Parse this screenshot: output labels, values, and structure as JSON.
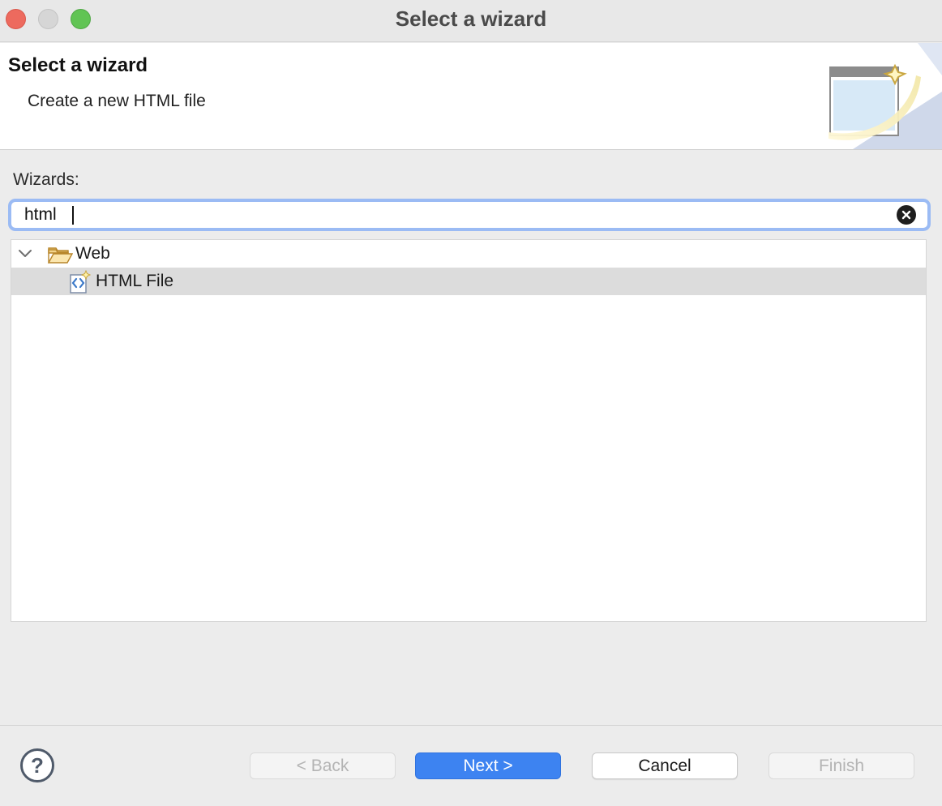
{
  "window": {
    "title": "Select a wizard"
  },
  "header": {
    "title": "Select a wizard",
    "description": "Create a new HTML file",
    "banner_icon": "new-wizard-banner-icon"
  },
  "filter": {
    "label": "Wizards:",
    "value": "html",
    "clear_icon": "clear-circle-icon"
  },
  "tree": {
    "items": [
      {
        "label": "Web",
        "icon": "open-folder-icon",
        "expanded": true,
        "level": 0
      },
      {
        "label": "HTML File",
        "icon": "html-file-wizard-icon",
        "selected": true,
        "level": 1
      }
    ]
  },
  "footer": {
    "help_label": "?",
    "back_label": "< Back",
    "next_label": "Next >",
    "cancel_label": "Cancel",
    "finish_label": "Finish"
  },
  "colors": {
    "accent": "#3d83f1",
    "focus_ring": "#9bbbf4",
    "selection": "#dcdcdc",
    "close": "#ed6a5e",
    "zoom": "#61c454"
  }
}
